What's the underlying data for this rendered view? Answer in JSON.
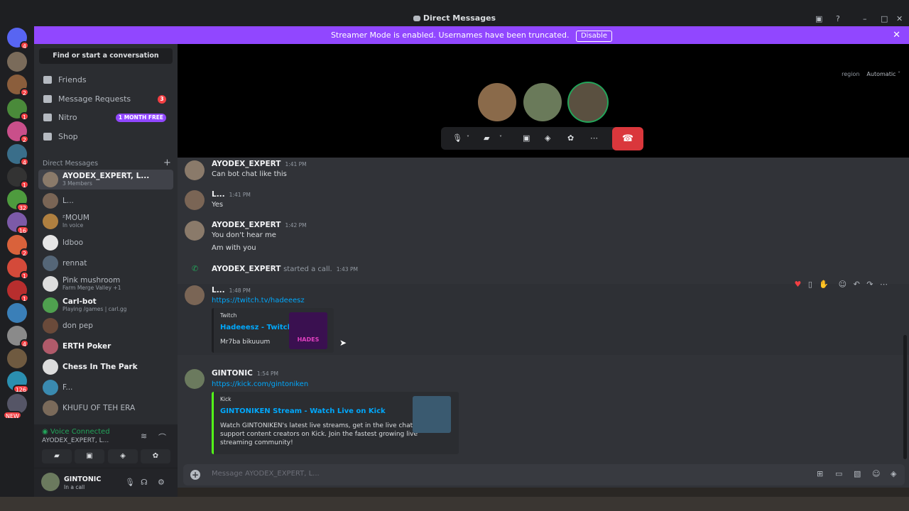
{
  "window": {
    "title": "Direct Messages"
  },
  "banner": {
    "text": "Streamer Mode is enabled. Usernames have been truncated.",
    "button": "Disable"
  },
  "servers": [
    {
      "badge": "4",
      "color": "#5865f2"
    },
    {
      "badge": "",
      "color": "#7a6b5a"
    },
    {
      "badge": "2",
      "color": "#8b5e3c"
    },
    {
      "badge": "1",
      "color": "#4a8a3a"
    },
    {
      "badge": "2",
      "color": "#c94f8a"
    },
    {
      "badge": "4",
      "color": "#3a6e8a"
    },
    {
      "badge": "1",
      "color": "#333333"
    },
    {
      "badge": "32",
      "color": "#4e9b3e"
    },
    {
      "badge": "16",
      "color": "#7c5aa8"
    },
    {
      "badge": "2",
      "color": "#d9623b"
    },
    {
      "badge": "1",
      "color": "#d44a3a"
    },
    {
      "badge": "1",
      "color": "#b82e2e"
    },
    {
      "badge": "",
      "color": "#3a7fb8"
    },
    {
      "badge": "4",
      "color": "#8a8a8a"
    },
    {
      "badge": "",
      "color": "#6f5a40"
    },
    {
      "badge": "126",
      "color": "#2b8fb0"
    },
    {
      "badge": "NEW",
      "color": "#555566"
    }
  ],
  "sidebar": {
    "search": "Find or start a conversation",
    "nav": [
      {
        "label": "Friends",
        "icon": "friends-icon"
      },
      {
        "label": "Message Requests",
        "badge": "3",
        "icon": "envelope-icon"
      },
      {
        "label": "Nitro",
        "pill": "1 MONTH FREE",
        "icon": "nitro-icon"
      },
      {
        "label": "Shop",
        "icon": "shop-icon"
      }
    ],
    "dm_header": "Direct Messages",
    "dms": [
      {
        "name": "AYODEX_EXPERT, L...",
        "sub": "3 Members",
        "color": "#8a7a6a"
      },
      {
        "name": "L...",
        "sub": "",
        "color": "#7a6555"
      },
      {
        "name": "ᶻMOUM",
        "sub": "In voice",
        "color": "#b08040"
      },
      {
        "name": "ldboo",
        "sub": "",
        "color": "#e6e6e6"
      },
      {
        "name": "rennat",
        "sub": "",
        "color": "#556677"
      },
      {
        "name": "Pink mushroom",
        "sub": "Farm Merge Valley +1",
        "color": "#dddddd"
      },
      {
        "name": "Carl-bot",
        "sub": "Playing /games | carl.gg",
        "color": "#4fa04f"
      },
      {
        "name": "don pep",
        "sub": "",
        "color": "#6a4a3a"
      },
      {
        "name": "ERTH Poker",
        "sub": "",
        "color": "#b05a6a"
      },
      {
        "name": "Chess In The Park",
        "sub": "",
        "color": "#dddddd"
      },
      {
        "name": "F...",
        "sub": "",
        "color": "#3a8ab0"
      },
      {
        "name": "KHUFU OF TEH ERA",
        "sub": "",
        "color": "#7a6a5a"
      }
    ]
  },
  "voice": {
    "title": "Voice Connected",
    "channel": "AYODEX_EXPERT, L..."
  },
  "user": {
    "name": "GINTONIC",
    "status": "In a call"
  },
  "call": {
    "region_label": "region",
    "region_value": "Automatic"
  },
  "messages": {
    "m1": {
      "user": "AYODEX_EXPERT",
      "time": "1:41 PM",
      "lines": [
        "Can bot chat like this"
      ]
    },
    "m2": {
      "user": "L...",
      "time": "1:41 PM",
      "lines": [
        "Yes"
      ]
    },
    "m3": {
      "user": "AYODEX_EXPERT",
      "time": "1:42 PM",
      "lines": [
        "You don't hear me",
        "Am with you"
      ]
    },
    "sys": {
      "user": "AYODEX_EXPERT",
      "text": "started a call.",
      "time": "1:43 PM"
    },
    "m4": {
      "user": "L...",
      "time": "1:48 PM",
      "link": "https://twitch.tv/hadeeesz",
      "embed": {
        "provider": "Twitch",
        "title": "Hadeeesz - Twitch",
        "desc": "Mr7ba bikuuum",
        "thumb_text": "HADES"
      }
    },
    "m5": {
      "user": "GINTONIC",
      "time": "1:54 PM",
      "link": "https://kick.com/gintoniken",
      "embed": {
        "provider": "Kick",
        "title": "GINTONIKEN Stream - Watch Live on Kick",
        "desc1": "Watch GINTONIKEN's latest live streams, get in the live chat &",
        "desc2": "support content creators on Kick. Join the fastest growing live",
        "desc3": "streaming community!"
      }
    }
  },
  "input": {
    "placeholder": "Message AYODEX_EXPERT, L..."
  }
}
